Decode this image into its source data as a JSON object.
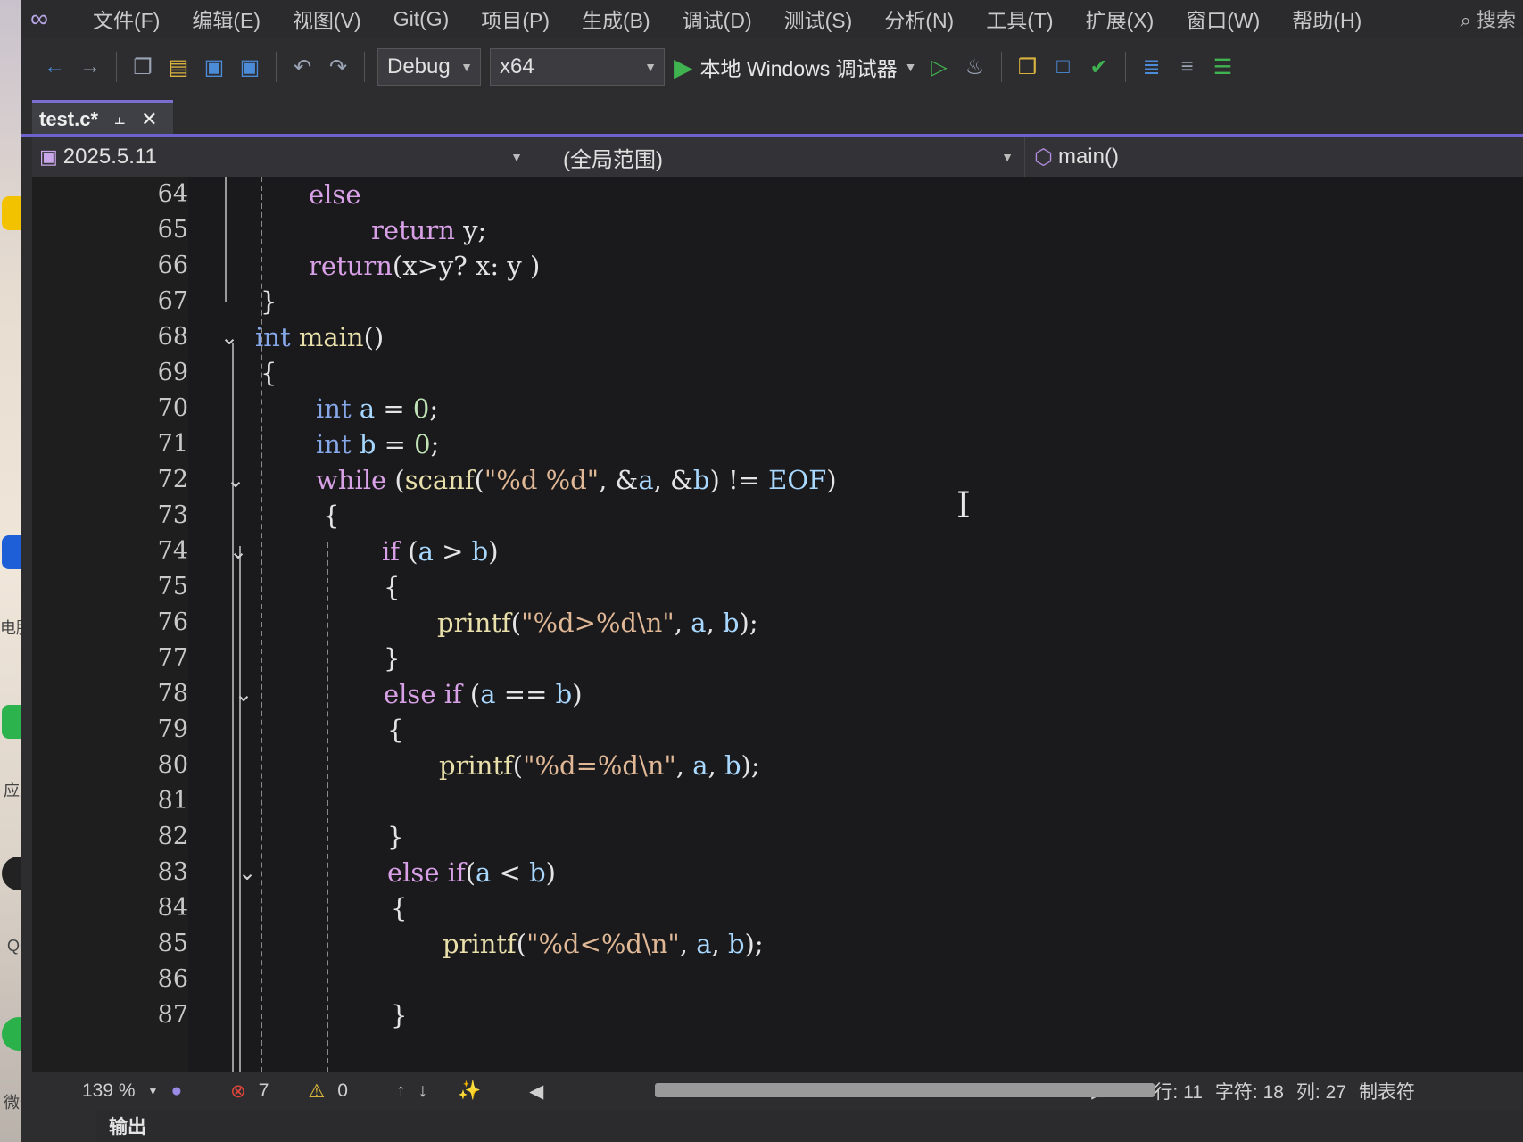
{
  "desktop": {
    "labels": [
      "电脑管",
      "应用",
      "QQ",
      "微信"
    ]
  },
  "menubar": {
    "items": [
      "文件(F)",
      "编辑(E)",
      "视图(V)",
      "Git(G)",
      "项目(P)",
      "生成(B)",
      "调试(D)",
      "测试(S)",
      "分析(N)",
      "工具(T)",
      "扩展(X)",
      "窗口(W)",
      "帮助(H)"
    ],
    "search": "搜索"
  },
  "toolbar": {
    "config": "Debug",
    "platform": "x64",
    "run_label": "本地 Windows 调试器"
  },
  "tab": {
    "title": "test.c*",
    "accent": "#7a6fd1"
  },
  "navbar": {
    "project": "2025.5.11",
    "scope": "(全局范围)",
    "member": "main()"
  },
  "editor": {
    "line_numbers": [
      "64",
      "65",
      "66",
      "67",
      "68",
      "69",
      "70",
      "71",
      "72",
      "73",
      "74",
      "75",
      "76",
      "77",
      "78",
      "79",
      "80",
      "81",
      "82",
      "83",
      "84",
      "85",
      "86",
      "87"
    ]
  },
  "status": {
    "zoom": "139 %",
    "errors": "7",
    "warnings": "0",
    "line": "行: 11",
    "char": "字符: 18",
    "col": "列: 27",
    "tab_mode": "制表符"
  },
  "output": {
    "title": "输出"
  },
  "colors": {
    "keyword": "#86a7e8",
    "control": "#d8a0e6",
    "function": "#e8dfaa",
    "string": "#e0b896",
    "number": "#bfe3b4",
    "variable": "#a8d8ff"
  }
}
